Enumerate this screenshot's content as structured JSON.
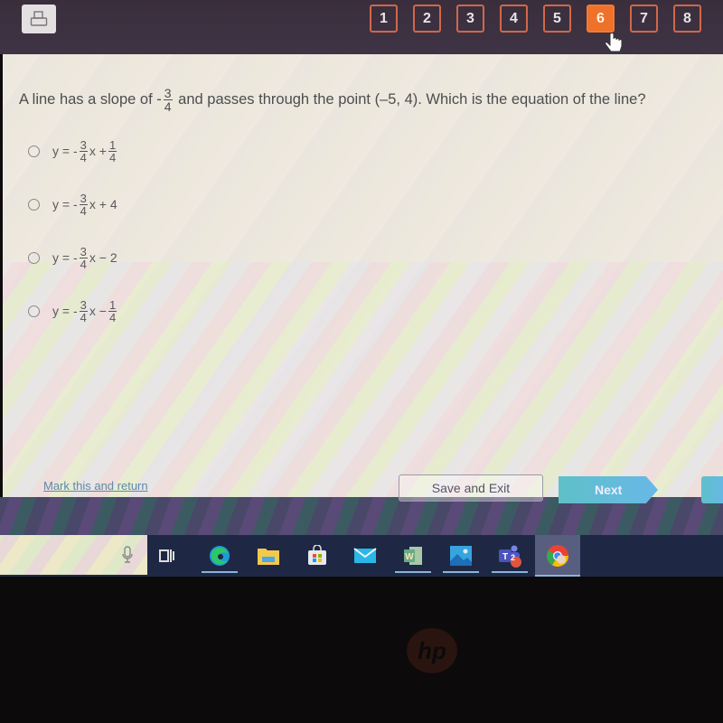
{
  "toolbar": {
    "print_icon": "printer-icon",
    "questions": [
      {
        "label": "1",
        "active": false
      },
      {
        "label": "2",
        "active": false
      },
      {
        "label": "3",
        "active": false
      },
      {
        "label": "4",
        "active": false
      },
      {
        "label": "5",
        "active": false
      },
      {
        "label": "6",
        "active": true
      },
      {
        "label": "7",
        "active": false
      },
      {
        "label": "8",
        "active": false
      }
    ],
    "accent_color": "#f0712a"
  },
  "question": {
    "prefix": "A line has a slope of ",
    "slope_sign": "-",
    "slope_num": "3",
    "slope_den": "4",
    "suffix": " and passes through the point (–5, 4). Which is the equation of the line?"
  },
  "options": [
    {
      "lead": "y = -",
      "num": "3",
      "den": "4",
      "mid": "x + ",
      "tail_num": "1",
      "tail_den": "4",
      "tail": ""
    },
    {
      "lead": "y = -",
      "num": "3",
      "den": "4",
      "mid": "x + 4",
      "tail_num": "",
      "tail_den": "",
      "tail": ""
    },
    {
      "lead": "y = -",
      "num": "3",
      "den": "4",
      "mid": "x − 2",
      "tail_num": "",
      "tail_den": "",
      "tail": ""
    },
    {
      "lead": "y = -",
      "num": "3",
      "den": "4",
      "mid": "x − ",
      "tail_num": "1",
      "tail_den": "4",
      "tail": ""
    }
  ],
  "footer": {
    "mark_link": "Mark this and return",
    "save_exit": "Save and Exit",
    "next": "Next"
  },
  "taskbar": {
    "icons": [
      "mic-icon",
      "task-view-icon",
      "edge-icon",
      "file-explorer-icon",
      "store-icon",
      "mail-icon",
      "word-icon",
      "photos-icon",
      "teams-icon",
      "chrome-icon"
    ],
    "teams_badge": "2"
  },
  "bezel": {
    "logo": "hp"
  }
}
